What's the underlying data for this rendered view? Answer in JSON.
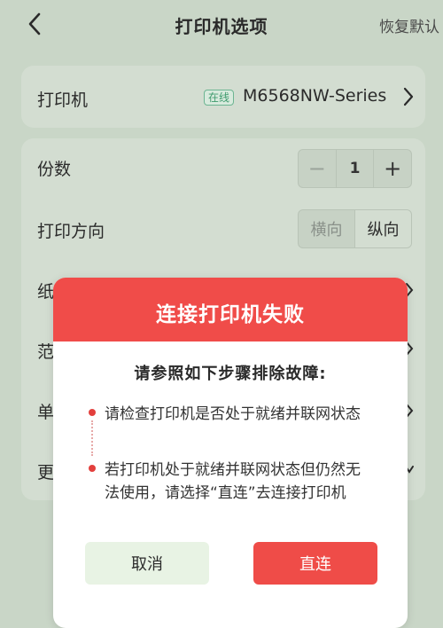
{
  "header": {
    "title": "打印机选项",
    "restore_label": "恢复默认"
  },
  "printer_card": {
    "label": "打印机",
    "status_badge": "在线",
    "model": "M6568NW-Series"
  },
  "settings": {
    "copies": {
      "label": "份数",
      "minus": "−",
      "value": "1",
      "plus": "+"
    },
    "orientation": {
      "label": "打印方向",
      "options": [
        "横向",
        "纵向"
      ],
      "selected": "纵向"
    },
    "rows_partially_hidden": [
      "纸",
      "范",
      "单",
      "更"
    ]
  },
  "dialog": {
    "title": "连接打印机失败",
    "subtitle": "请参照如下步骤排除故障:",
    "steps": [
      "请检查打印机是否处于就绪并联网状态",
      "若打印机处于就绪并联网状态但仍然无法使用，请选择“直连”去连接打印机"
    ],
    "cancel_label": "取消",
    "confirm_label": "直连"
  },
  "colors": {
    "background": "#c9d6c7",
    "card": "#d3ddd1",
    "dialog_header": "#f04c49",
    "confirm_button": "#ef4c48",
    "cancel_button": "#e8f3e4",
    "online_badge": "#3f9b6e"
  },
  "icons": {
    "back": "chevron-left-icon",
    "row_arrow": "chevron-right-icon",
    "bullet": "red-dot-icon"
  }
}
